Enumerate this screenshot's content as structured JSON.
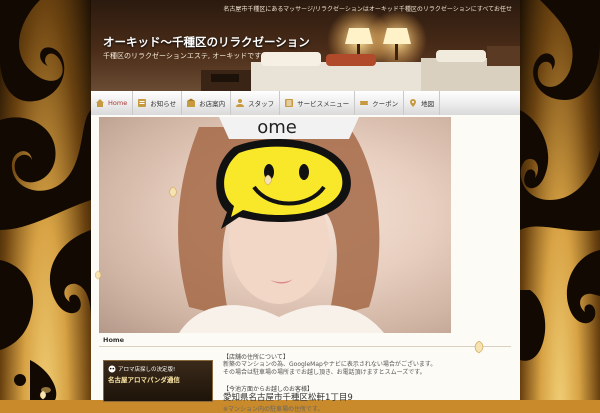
{
  "header": {
    "site_description": "名古屋市千種区にあるマッサージ/リラクゼーションはオーキッド千種区のリラクゼーションにすべてお任せ",
    "title": "オーキッド〜千種区のリラクゼーション",
    "subtitle": "千種区のリラクゼーションエステ, オーキッドです♪"
  },
  "nav": {
    "items": [
      {
        "label": "Home"
      },
      {
        "label": "お知らせ"
      },
      {
        "label": "お店案内"
      },
      {
        "label": "スタッフ"
      },
      {
        "label": "サービスメニュー"
      },
      {
        "label": "クーポン"
      },
      {
        "label": "地図"
      }
    ]
  },
  "hero": {
    "sticker_text": "ome"
  },
  "breadcrumb": {
    "home": "Home"
  },
  "sidebar": {
    "banner_small": "アロマ店探しの決定版!",
    "banner_big": "名古屋アロマパンダ通信"
  },
  "content": {
    "heading1": "【店舗の住所について】",
    "text1a": "新築のマンションの為、GoogleMapやナビに表示されない場合がございます。",
    "text1b": "その場合は駐車場の場所までお越し頂き、お電話頂けますとスムーズです。",
    "heading2": "【今池方面からお越しのお客様】",
    "address": "愛知県名古屋市千種区松軒1丁目9",
    "note": "※マンション内の駐車場の住所です。"
  },
  "colors": {
    "accent": "#a33333",
    "gold": "#d7a244",
    "nav_bg": "#ececec"
  }
}
